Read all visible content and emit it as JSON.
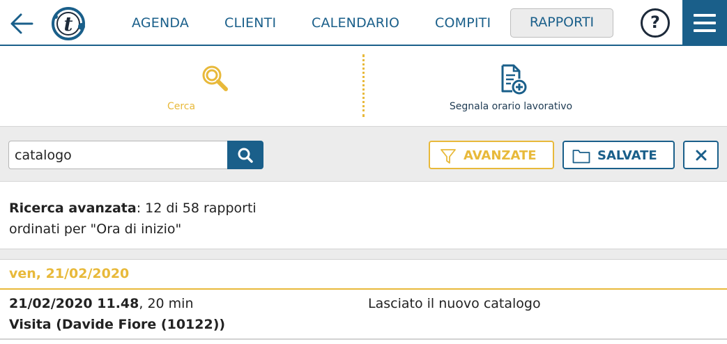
{
  "nav": {
    "back_icon": "arrow-left-icon",
    "logo_letter": "t",
    "items": [
      {
        "label": "AGENDA"
      },
      {
        "label": "CLIENTI"
      },
      {
        "label": "CALENDARIO"
      },
      {
        "label": "COMPITI"
      }
    ],
    "active_item": "RAPPORTI",
    "help_label": "?",
    "menu_icon": "hamburger-menu-icon"
  },
  "actions": {
    "search_label": "Cerca",
    "search_icon": "magnifier-icon",
    "report_label": "Segnala orario lavorativo",
    "report_icon": "document-add-icon"
  },
  "search": {
    "value": "catalogo",
    "advanced_label": "AVANZATE",
    "saved_label": "SALVATE",
    "clear_icon": "close-icon"
  },
  "summary": {
    "bold_label": "Ricerca avanzata",
    "count_text": ": 12 di 58 rapporti",
    "order_text": "ordinati per \"Ora di inizio\""
  },
  "group": {
    "date_label": "ven, 21/02/2020",
    "entries": [
      {
        "datetime": "21/02/2020 11.48",
        "duration": ", 20 min",
        "title": "Visita (Davide Fiore (10122))",
        "description": "Lasciato il nuovo catalogo"
      }
    ]
  },
  "colors": {
    "primary": "#1a5f8a",
    "accent": "#e8b93a",
    "band": "#ececec"
  }
}
